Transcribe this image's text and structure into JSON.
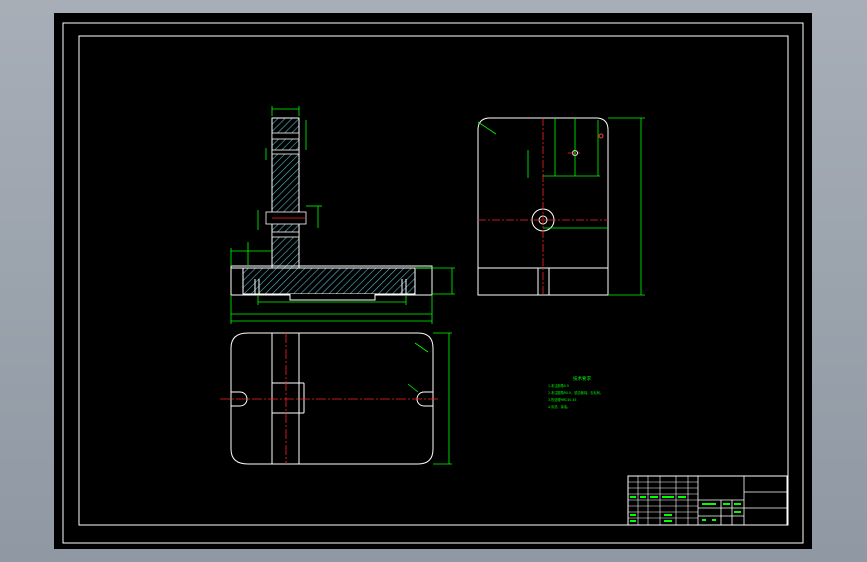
{
  "colors": {
    "background": "#000000",
    "outline": "#ffffff",
    "dimension": "#00ff00",
    "centerline": "#ff2020",
    "hatch": "#58b7c8",
    "workspace": "#9aa3ad"
  },
  "drawing": {
    "notes_title": "技术要求",
    "notes": [
      "1.未注倒角0.5",
      "2.未注圆角R0.5，锐边倒钝，去毛刺。",
      "3.热处理HRC40-45",
      "4.清洗、涂油。"
    ]
  }
}
